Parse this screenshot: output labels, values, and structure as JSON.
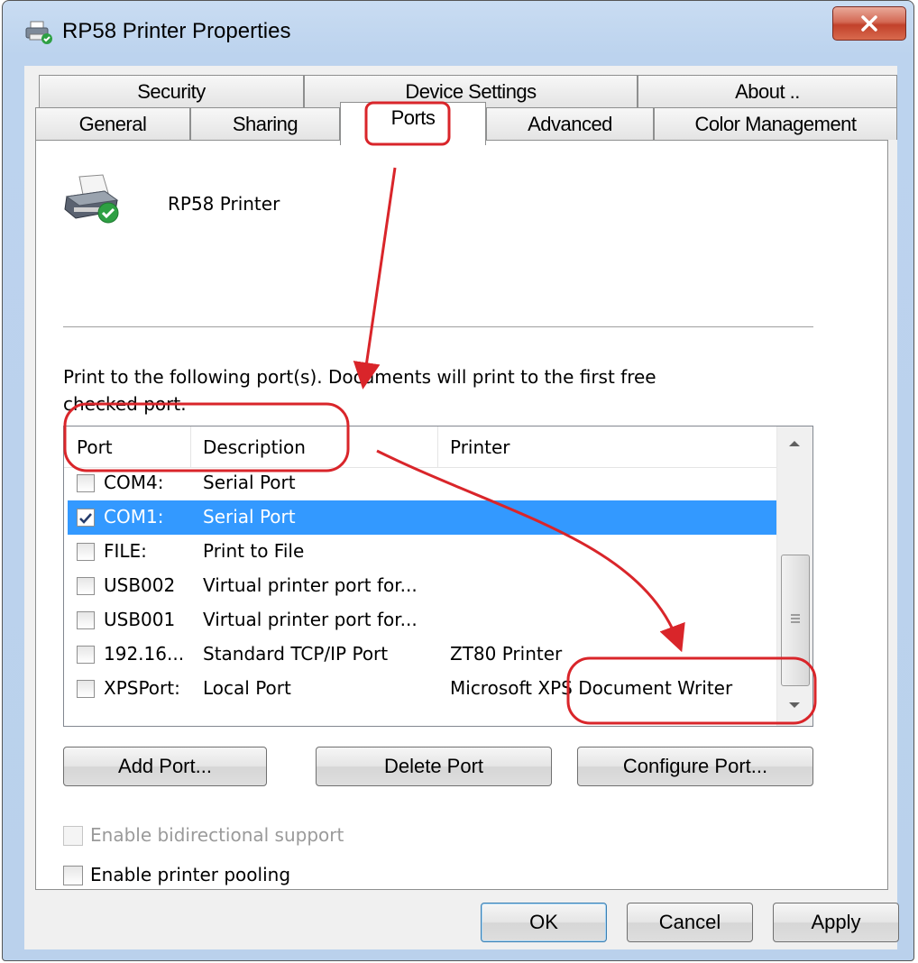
{
  "window": {
    "title": "RP58 Printer Properties"
  },
  "tabs": {
    "row1": [
      "Security",
      "Device Settings",
      "About .."
    ],
    "row2": [
      "General",
      "Sharing",
      "Ports",
      "Advanced",
      "Color Management"
    ],
    "active": "Ports"
  },
  "printer": {
    "name": "RP58 Printer"
  },
  "instructions": {
    "line1": "Print to the following port(s). Documents will print to the first free",
    "line2": "checked port."
  },
  "port_list": {
    "columns": [
      "Port",
      "Description",
      "Printer"
    ],
    "rows": [
      {
        "port": "COM4:",
        "description": "Serial Port",
        "printer": "",
        "checked": false,
        "selected": false
      },
      {
        "port": "COM1:",
        "description": "Serial Port",
        "printer": "",
        "checked": true,
        "selected": true
      },
      {
        "port": "FILE:",
        "description": "Print to File",
        "printer": "",
        "checked": false,
        "selected": false
      },
      {
        "port": "USB002",
        "description": "Virtual printer port for...",
        "printer": "",
        "checked": false,
        "selected": false
      },
      {
        "port": "USB001",
        "description": "Virtual printer port for...",
        "printer": "",
        "checked": false,
        "selected": false
      },
      {
        "port": "192.16...",
        "description": "Standard TCP/IP Port",
        "printer": "ZT80 Printer",
        "checked": false,
        "selected": false
      },
      {
        "port": "XPSPort:",
        "description": "Local Port",
        "printer": "Microsoft XPS Document Writer",
        "checked": false,
        "selected": false
      }
    ]
  },
  "buttons": {
    "add_port": "Add Port...",
    "delete_port": "Delete Port",
    "configure_port": "Configure Port...",
    "ok": "OK",
    "cancel": "Cancel",
    "apply": "Apply"
  },
  "options": {
    "bidirectional": "Enable bidirectional support",
    "pooling": "Enable printer pooling"
  },
  "colors": {
    "selection": "#3399ff",
    "annotation": "#d9252a"
  }
}
